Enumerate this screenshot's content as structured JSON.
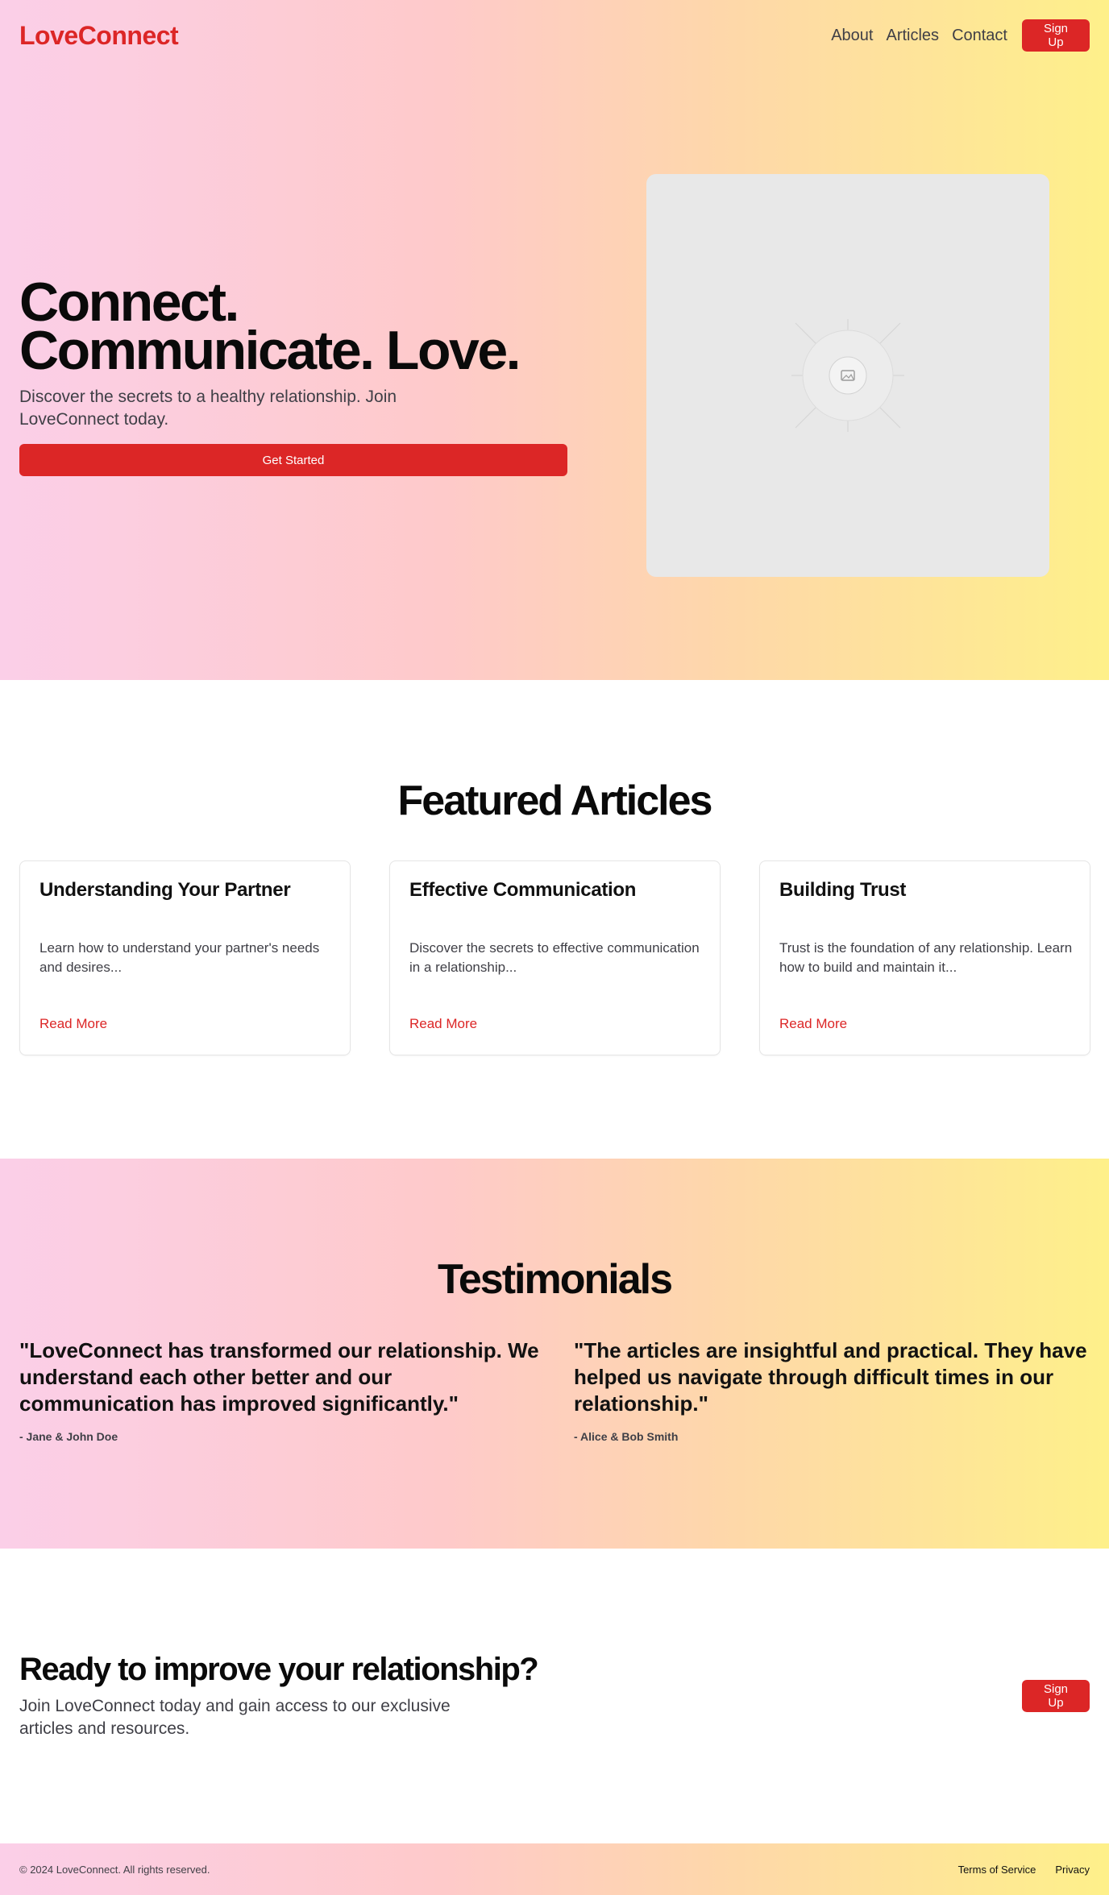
{
  "brand": {
    "name": "LoveConnect",
    "accent": "#dc2626"
  },
  "nav": {
    "links": [
      "About",
      "Articles",
      "Contact"
    ],
    "signup": "Sign Up"
  },
  "hero": {
    "title": "Connect. Communicate. Love.",
    "subtitle": "Discover the secrets to a healthy relationship. Join LoveConnect today.",
    "cta": "Get Started",
    "image_icon": "image-placeholder-icon"
  },
  "featured": {
    "title": "Featured Articles",
    "articles": [
      {
        "title": "Understanding Your Partner",
        "body": "Learn how to understand your partner's needs and desires...",
        "link": "Read More"
      },
      {
        "title": "Effective Communication",
        "body": "Discover the secrets to effective communication in a relationship...",
        "link": "Read More"
      },
      {
        "title": "Building Trust",
        "body": "Trust is the foundation of any relationship. Learn how to build and maintain it...",
        "link": "Read More"
      }
    ]
  },
  "testimonials": {
    "title": "Testimonials",
    "items": [
      {
        "quote": "\"LoveConnect has transformed our relationship. We understand each other better and our communication has improved significantly.\"",
        "author": "- Jane & John Doe"
      },
      {
        "quote": "\"The articles are insightful and practical. They have helped us navigate through difficult times in our relationship.\"",
        "author": "- Alice & Bob Smith"
      }
    ]
  },
  "cta": {
    "title": "Ready to improve your relationship?",
    "subtitle": "Join LoveConnect today and gain access to our exclusive articles and resources.",
    "button": "Sign Up"
  },
  "footer": {
    "copyright": "© 2024 LoveConnect. All rights reserved.",
    "links": [
      "Terms of Service",
      "Privacy"
    ]
  }
}
